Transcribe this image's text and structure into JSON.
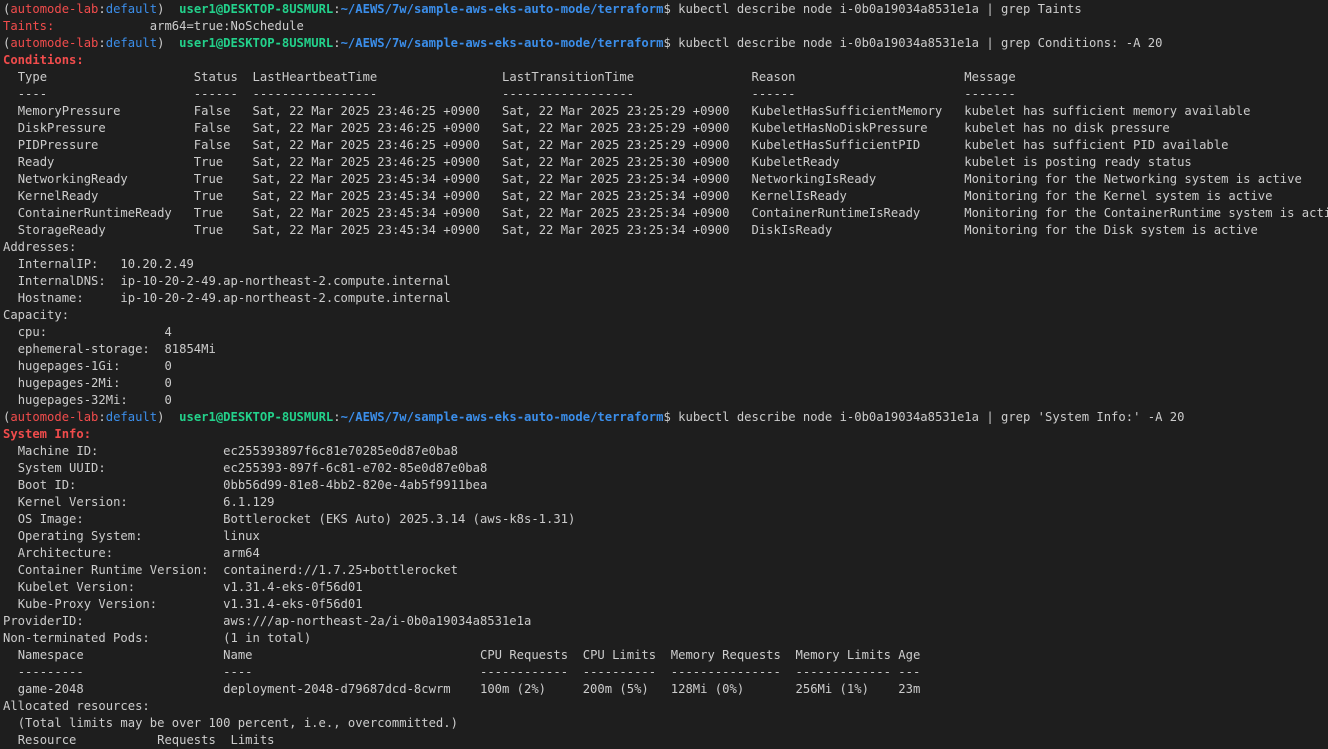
{
  "terminal": {
    "prompt": {
      "open_paren": "(",
      "cluster": "automode-lab",
      "colon": ":",
      "namespace": "default",
      "close_paren": ")",
      "user_host": "user1@DESKTOP-8USMURL",
      "path_colon": ":",
      "path": "~/AEWS/7w/sample-aws-eks-auto-mode/terraform",
      "dollar": "$"
    },
    "commands": [
      "kubectl describe node i-0b0a19034a8531e1a | grep Taints",
      "kubectl describe node i-0b0a19034a8531e1a | grep Conditions: -A 20",
      "kubectl describe node i-0b0a19034a8531e1a | grep 'System Info:' -A 20"
    ],
    "taints": {
      "key": "Taints:",
      "value": "arm64=true:NoSchedule"
    },
    "conditions": {
      "heading": "Conditions:",
      "headers": [
        "Type",
        "Status",
        "LastHeartbeatTime",
        "LastTransitionTime",
        "Reason",
        "Message"
      ],
      "dashes": [
        "----",
        "------",
        "-----------------",
        "------------------",
        "------",
        "-------"
      ],
      "rows": [
        [
          "MemoryPressure",
          "False",
          "Sat, 22 Mar 2025 23:46:25 +0900",
          "Sat, 22 Mar 2025 23:25:29 +0900",
          "KubeletHasSufficientMemory",
          "kubelet has sufficient memory available"
        ],
        [
          "DiskPressure",
          "False",
          "Sat, 22 Mar 2025 23:46:25 +0900",
          "Sat, 22 Mar 2025 23:25:29 +0900",
          "KubeletHasNoDiskPressure",
          "kubelet has no disk pressure"
        ],
        [
          "PIDPressure",
          "False",
          "Sat, 22 Mar 2025 23:46:25 +0900",
          "Sat, 22 Mar 2025 23:25:29 +0900",
          "KubeletHasSufficientPID",
          "kubelet has sufficient PID available"
        ],
        [
          "Ready",
          "True",
          "Sat, 22 Mar 2025 23:46:25 +0900",
          "Sat, 22 Mar 2025 23:25:30 +0900",
          "KubeletReady",
          "kubelet is posting ready status"
        ],
        [
          "NetworkingReady",
          "True",
          "Sat, 22 Mar 2025 23:45:34 +0900",
          "Sat, 22 Mar 2025 23:25:34 +0900",
          "NetworkingIsReady",
          "Monitoring for the Networking system is active"
        ],
        [
          "KernelReady",
          "True",
          "Sat, 22 Mar 2025 23:45:34 +0900",
          "Sat, 22 Mar 2025 23:25:34 +0900",
          "KernelIsReady",
          "Monitoring for the Kernel system is active"
        ],
        [
          "ContainerRuntimeReady",
          "True",
          "Sat, 22 Mar 2025 23:45:34 +0900",
          "Sat, 22 Mar 2025 23:25:34 +0900",
          "ContainerRuntimeIsReady",
          "Monitoring for the ContainerRuntime system is active"
        ],
        [
          "StorageReady",
          "True",
          "Sat, 22 Mar 2025 23:45:34 +0900",
          "Sat, 22 Mar 2025 23:25:34 +0900",
          "DiskIsReady",
          "Monitoring for the Disk system is active"
        ]
      ]
    },
    "addresses": {
      "heading": "Addresses:",
      "items": [
        [
          "InternalIP:",
          "10.20.2.49"
        ],
        [
          "InternalDNS:",
          "ip-10-20-2-49.ap-northeast-2.compute.internal"
        ],
        [
          "Hostname:",
          "ip-10-20-2-49.ap-northeast-2.compute.internal"
        ]
      ]
    },
    "capacity": {
      "heading": "Capacity:",
      "items": [
        [
          "cpu:",
          "4"
        ],
        [
          "ephemeral-storage:",
          "81854Mi"
        ],
        [
          "hugepages-1Gi:",
          "0"
        ],
        [
          "hugepages-2Mi:",
          "0"
        ],
        [
          "hugepages-32Mi:",
          "0"
        ]
      ]
    },
    "system_info": {
      "heading": "System Info:",
      "items": [
        [
          "Machine ID:",
          "ec255393897f6c81e70285e0d87e0ba8"
        ],
        [
          "System UUID:",
          "ec255393-897f-6c81-e702-85e0d87e0ba8"
        ],
        [
          "Boot ID:",
          "0bb56d99-81e8-4bb2-820e-4ab5f9911bea"
        ],
        [
          "Kernel Version:",
          "6.1.129"
        ],
        [
          "OS Image:",
          "Bottlerocket (EKS Auto) 2025.3.14 (aws-k8s-1.31)"
        ],
        [
          "Operating System:",
          "linux"
        ],
        [
          "Architecture:",
          "arm64"
        ],
        [
          "Container Runtime Version:",
          "containerd://1.7.25+bottlerocket"
        ],
        [
          "Kubelet Version:",
          "v1.31.4-eks-0f56d01"
        ],
        [
          "Kube-Proxy Version:",
          "v1.31.4-eks-0f56d01"
        ]
      ]
    },
    "provider_id": {
      "key": "ProviderID:",
      "value": "aws:///ap-northeast-2a/i-0b0a19034a8531e1a"
    },
    "pods": {
      "key": "Non-terminated Pods:",
      "value": "(1 in total)",
      "headers": [
        "Namespace",
        "Name",
        "CPU Requests",
        "CPU Limits",
        "Memory Requests",
        "Memory Limits",
        "Age"
      ],
      "dashes": [
        "---------",
        "----",
        "------------",
        "----------",
        "---------------",
        "-------------",
        "---"
      ],
      "rows": [
        [
          "game-2048",
          "deployment-2048-d79687dcd-8cwrm",
          "100m (2%)",
          "200m (5%)",
          "128Mi (0%)",
          "256Mi (1%)",
          "23m"
        ]
      ]
    },
    "allocated": {
      "heading": "Allocated resources:",
      "note": "(Total limits may be over 100 percent, i.e., overcommitted.)",
      "headers": [
        "Resource",
        "Requests",
        "Limits"
      ]
    }
  }
}
